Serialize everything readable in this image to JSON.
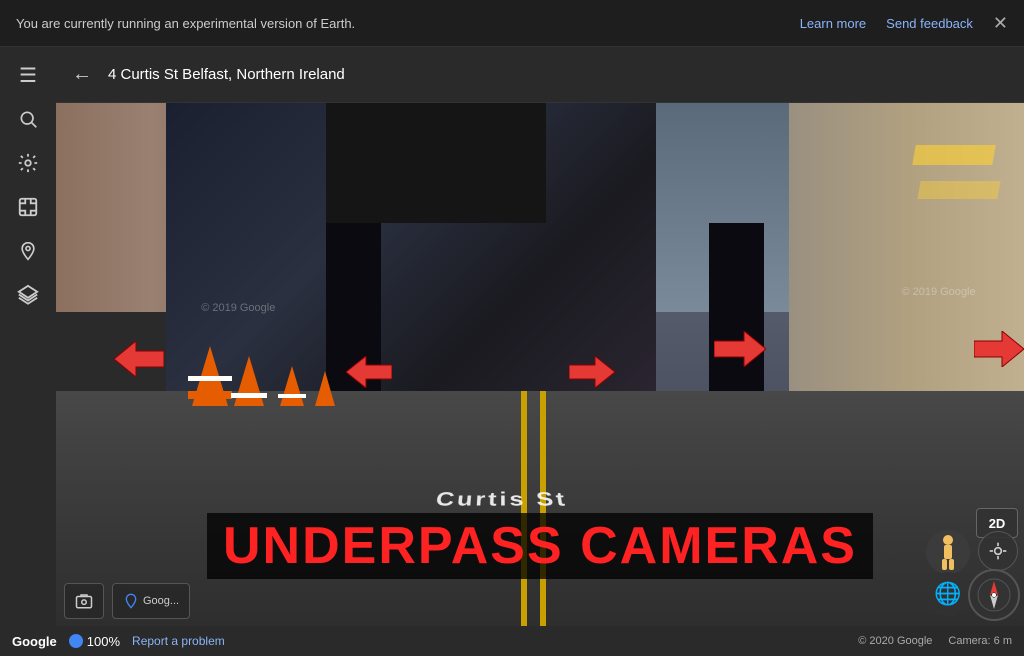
{
  "notification": {
    "text": "You are currently running an experimental version of Earth.",
    "learn_more": "Learn more",
    "send_feedback": "Send feedback",
    "close_label": "✕"
  },
  "search": {
    "address": "4 Curtis St Belfast, Northern Ireland",
    "back_label": "←"
  },
  "sidebar": {
    "menu_icon": "☰",
    "search_icon": "🔍",
    "layers_icon": "⚙",
    "fullscreen_icon": "⊞",
    "location_icon": "📍",
    "bookmark_icon": "◇"
  },
  "overlay": {
    "big_text": "UNDERPASS CAMERAS"
  },
  "controls": {
    "pegman_icon": "🧍",
    "location_icon": "⊕",
    "view_2d": "2D",
    "globe_icon": "🌐"
  },
  "status": {
    "logo": "Google",
    "zoom": "100%",
    "report": "Report a problem",
    "copyright": "© 2020 Google",
    "camera": "Camera: 6 m"
  },
  "arrows": [
    {
      "id": "arrow-left-far",
      "label": "←"
    },
    {
      "id": "arrow-left-mid",
      "label": "←"
    },
    {
      "id": "arrow-right-far",
      "label": "→"
    },
    {
      "id": "arrow-right-mid",
      "label": "→"
    },
    {
      "id": "arrow-right-close",
      "label": "→"
    }
  ],
  "street_name": "Curtis St",
  "colors": {
    "accent_blue": "#8ab4f8",
    "red_arrow": "#e53935",
    "overlay_red": "#ff2222",
    "background_dark": "#2a2a2a"
  }
}
